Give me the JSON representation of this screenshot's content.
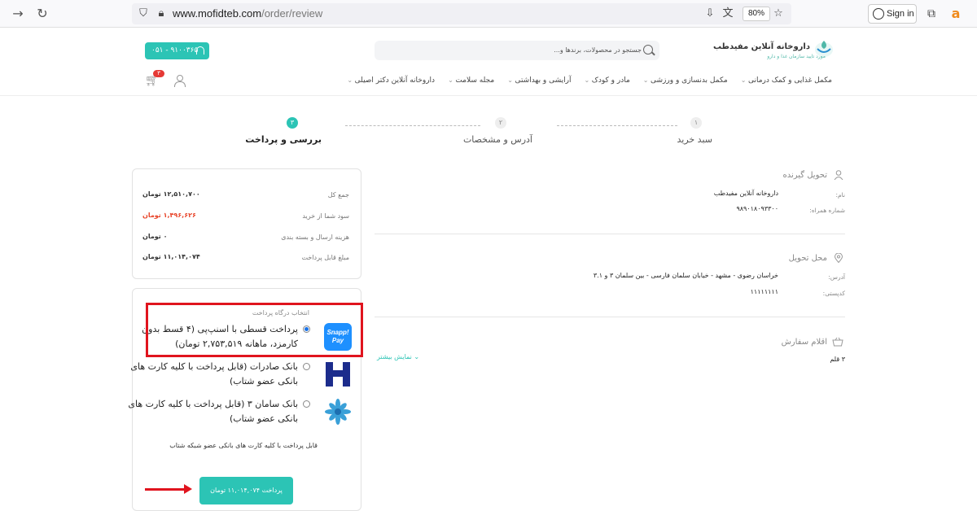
{
  "browser": {
    "url_host": "www.mofidteb.com",
    "url_path": "/order/review",
    "zoom": "80%",
    "signin_label": "Sign in"
  },
  "header": {
    "logo_title": "داروخانه آنلاین مفیدطب",
    "logo_subtitle": "مورد تایید سازمان غذا و دارو",
    "search_placeholder": "جستجو در محصولات، برندها و...",
    "phone": "۰۵۱ - ۹۱۰۰۳۶۵",
    "cart_count": "۳",
    "menu": [
      "مکمل غذایی و کمک درمانی",
      "مکمل بدنسازی و ورزشی",
      "مادر و کودک",
      "آرایشی و بهداشتی",
      "مجله سلامت",
      "داروخانه آنلاین دکتر اصیلی"
    ]
  },
  "steps": [
    {
      "num": "۱",
      "label": "سبد خرید"
    },
    {
      "num": "۲",
      "label": "آدرس و مشخصات"
    },
    {
      "num": "۳",
      "label": "بررسی و پرداخت"
    }
  ],
  "summary": {
    "total_label": "جمع کل",
    "total_value": "۱۲,۵۱۰,۷۰۰ تومان",
    "profit_label": "سود شما از خرید",
    "profit_value": "۱,۴۹۶,۶۲۶ تومان",
    "shipping_label": "هزینه ارسال و بسته بندی",
    "shipping_value": "۰ تومان",
    "payable_label": "مبلغ قابل پرداخت",
    "payable_value": "۱۱,۰۱۴,۰۷۴ تومان"
  },
  "payment": {
    "heading": "انتخاب درگاه پرداخت",
    "options": [
      {
        "line1": "پرداخت قسطی با اسنپ‌پی (۴ قسط بدون",
        "line2": "کارمزد، ماهانه ۲,۷۵۳,۵۱۹ تومان)",
        "logo": "Snapp! Pay"
      },
      {
        "line1": "بانک صادرات (قابل پرداخت با کلیه کارت های",
        "line2": "بانکی عضو شتاب)"
      },
      {
        "line1": "بانک سامان ۳ (قابل پرداخت با کلیه کارت های",
        "line2": "بانکی عضو شتاب)"
      }
    ],
    "note": "قابل پرداخت با کلیه کارت های بانکی عضو شبکه شتاب",
    "button": "پرداخت ۱۱,۰۱۴,۰۷۴ تومان"
  },
  "receiver": {
    "title": "تحویل گیرنده",
    "name_label": "نام:",
    "name_value": "داروخانه آنلاین مفیدطب",
    "phone_label": "شماره همراه:",
    "phone_value": "۹۸۹۰۱۸۰۹۳۳۰۰"
  },
  "delivery": {
    "title": "محل تحویل",
    "address_label": "آدرس:",
    "address_value": "خراسان رضوی - مشهد - خیابان سلمان فارسی - بین سلمان ۳ و ۳.۱",
    "postal_label": "کدپستی:",
    "postal_value": "۱۱۱۱۱۱۱۱"
  },
  "items": {
    "title": "اقلام سفارش",
    "count": "۳ قلم",
    "show_more": "نمایش بیشتر"
  }
}
